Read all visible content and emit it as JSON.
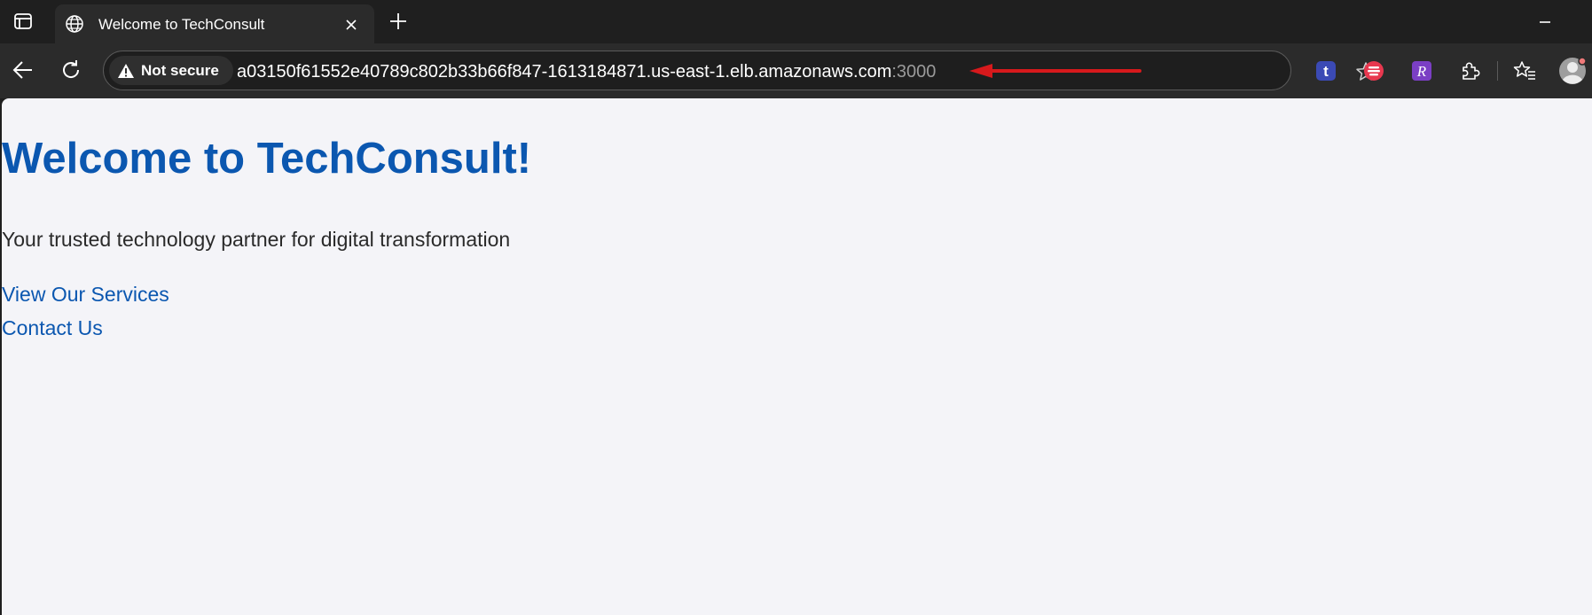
{
  "browser": {
    "tab": {
      "title": "Welcome to TechConsult"
    },
    "address_bar": {
      "security_label": "Not secure",
      "url_host": "a03150f61552e40789c802b33b66f847-1613184871.us-east-1.elb.amazonaws.com",
      "url_port": ":3000"
    },
    "extensions": [
      {
        "name": "t-extension-icon",
        "glyph": "t",
        "color": "#3b4ab5"
      },
      {
        "name": "red-extension-icon",
        "glyph": "",
        "color": "#e8384f"
      },
      {
        "name": "r-extension-icon",
        "glyph": "R",
        "color": "#7b3fc4"
      }
    ],
    "annotation_color": "#d7191c"
  },
  "page": {
    "title": "Welcome to TechConsult!",
    "tagline": "Your trusted technology partner for digital transformation",
    "links": [
      {
        "label": "View Our Services"
      },
      {
        "label": "Contact Us"
      }
    ],
    "accent_color": "#0b57b0",
    "background_color": "#f4f4f8"
  }
}
